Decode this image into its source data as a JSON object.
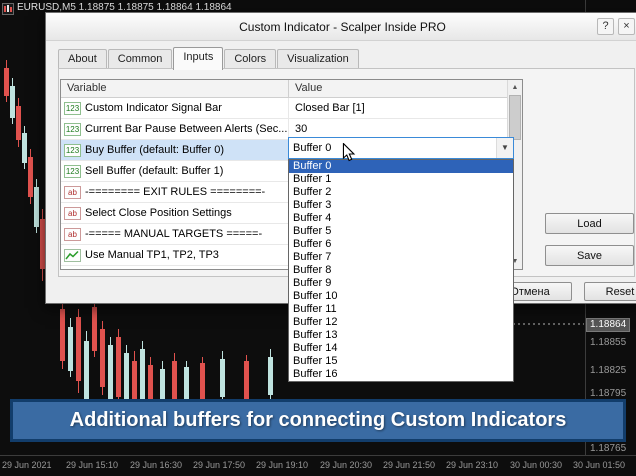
{
  "chart": {
    "symbol_info": "EURUSD,M5 1.18875 1.18875 1.18864 1.18864",
    "current_price": "1.18864",
    "price_labels": [
      "1.18864",
      "1.18855",
      "1.18825",
      "1.18795",
      "1.18765"
    ],
    "time_labels": [
      "29 Jun 2021",
      "29 Jun 15:10",
      "29 Jun 16:30",
      "29 Jun 17:50",
      "29 Jun 19:10",
      "29 Jun 20:30",
      "29 Jun 21:50",
      "29 Jun 23:10",
      "30 Jun 00:30",
      "30 Jun 01:50"
    ]
  },
  "dialog": {
    "title": "Custom Indicator - Scalper Inside PRO",
    "help_label": "?",
    "close_label": "×",
    "tabs": [
      "About",
      "Common",
      "Inputs",
      "Colors",
      "Visualization"
    ],
    "active_tab": "Inputs",
    "grid": {
      "columns": [
        "Variable",
        "Value"
      ],
      "rows": [
        {
          "icon": "123",
          "variable": "Custom Indicator Signal Bar",
          "value": "Closed Bar [1]"
        },
        {
          "icon": "123",
          "variable": "Current Bar Pause Between Alerts (Sec...",
          "value": "30"
        },
        {
          "icon": "123",
          "variable": "Buy Buffer (default: Buffer 0)",
          "value": "Buffer 0",
          "selected": true
        },
        {
          "icon": "123",
          "variable": "Sell Buffer (default: Buffer 1)",
          "value": ""
        },
        {
          "icon": "ab",
          "variable": "-========  EXIT RULES  ========-",
          "value": ""
        },
        {
          "icon": "ab",
          "variable": "Select Close Position Settings",
          "value": ""
        },
        {
          "icon": "ab",
          "variable": "-=====  MANUAL TARGETS  =====-",
          "value": ""
        },
        {
          "icon": "chart",
          "variable": "Use Manual TP1, TP2, TP3",
          "value": ""
        }
      ]
    },
    "combobox": {
      "value": "Buffer 0"
    },
    "dropdown_items": [
      "Buffer 0",
      "Buffer 1",
      "Buffer 2",
      "Buffer 3",
      "Buffer 4",
      "Buffer 5",
      "Buffer 6",
      "Buffer 7",
      "Buffer 8",
      "Buffer 9",
      "Buffer 10",
      "Buffer 11",
      "Buffer 12",
      "Buffer 13",
      "Buffer 14",
      "Buffer 15",
      "Buffer 16"
    ],
    "dropdown_selected": "Buffer 0",
    "buttons": {
      "load": "Load",
      "save": "Save",
      "cancel": "Отмена",
      "reset": "Reset"
    }
  },
  "banner": {
    "text": "Additional buffers for connecting Custom Indicators"
  },
  "icons": {
    "scroll_up": "▲",
    "scroll_down": "▼",
    "combo_arrow": "▼"
  },
  "colors": {
    "accent": "#2e63b8",
    "banner_bg": "#3a6ba3",
    "banner_border": "#123d6b",
    "bear_candle": "#e0524e",
    "bull_candle": "#bfe3df"
  }
}
